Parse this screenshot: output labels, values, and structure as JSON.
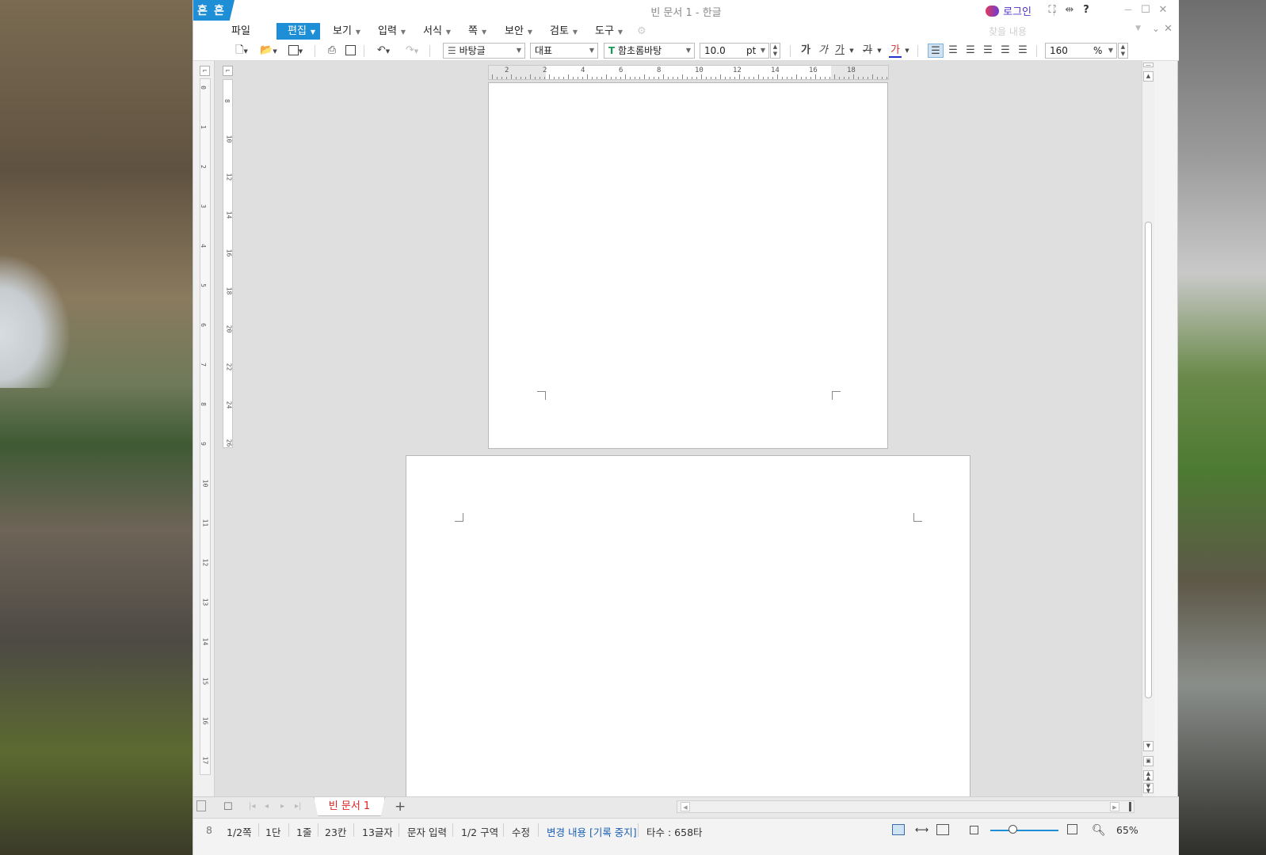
{
  "window": {
    "title": "빈 문서 1 - 한글",
    "logo_glyphs": [
      "흔",
      "흔"
    ],
    "login_label": "로그인",
    "buttons": {
      "fullscreen": "⛶",
      "split": "⇹",
      "help": "?",
      "minimize": "—",
      "maximize": "☐",
      "close": "✕"
    }
  },
  "menu": {
    "items": [
      {
        "label": "파일"
      },
      {
        "label": "편집"
      },
      {
        "label": "보기"
      },
      {
        "label": "입력"
      },
      {
        "label": "서식"
      },
      {
        "label": "쪽"
      },
      {
        "label": "보안"
      },
      {
        "label": "검토"
      },
      {
        "label": "도구"
      }
    ],
    "search_placeholder": "찾을 내용"
  },
  "toolbar": {
    "style": "바탕글",
    "lang": "대표",
    "font": "함초롬바탕",
    "size": "10.0",
    "size_unit": "pt",
    "char_bold": "가",
    "char_italic": "가",
    "char_underline": "가",
    "char_strike": "가",
    "char_color": "가",
    "line_spacing": "160",
    "line_spacing_unit": "%"
  },
  "ruler": {
    "h_labels": [
      "2",
      "2",
      "4",
      "6",
      "8",
      "10",
      "12",
      "14",
      "16",
      "18"
    ],
    "v_labels": [
      "8",
      "10",
      "12",
      "14",
      "16",
      "18",
      "20",
      "22",
      "24",
      "26"
    ],
    "outer_labels": [
      "0",
      "1",
      "2",
      "3",
      "4",
      "5",
      "6",
      "7",
      "8",
      "9",
      "10",
      "11",
      "12",
      "13",
      "14",
      "15",
      "16",
      "17"
    ]
  },
  "tabs": {
    "document": "빈 문서 1",
    "add": "+"
  },
  "status": {
    "page": "1/2쪽",
    "column": "1단",
    "line": "1줄",
    "col_pos": "23칸",
    "chars": "13글자",
    "input_mode": "문자 입력",
    "section": "1/2 구역",
    "edit_mode": "수정",
    "track_changes": "변경 내용 [기록 중지]",
    "typing_speed": "타수 : 658타",
    "zoom": "65%",
    "left_cut": "8"
  },
  "colors": {
    "accent": "#1e8fd6",
    "track_text": "#1a5fb4",
    "tab_text": "#dd2222"
  }
}
